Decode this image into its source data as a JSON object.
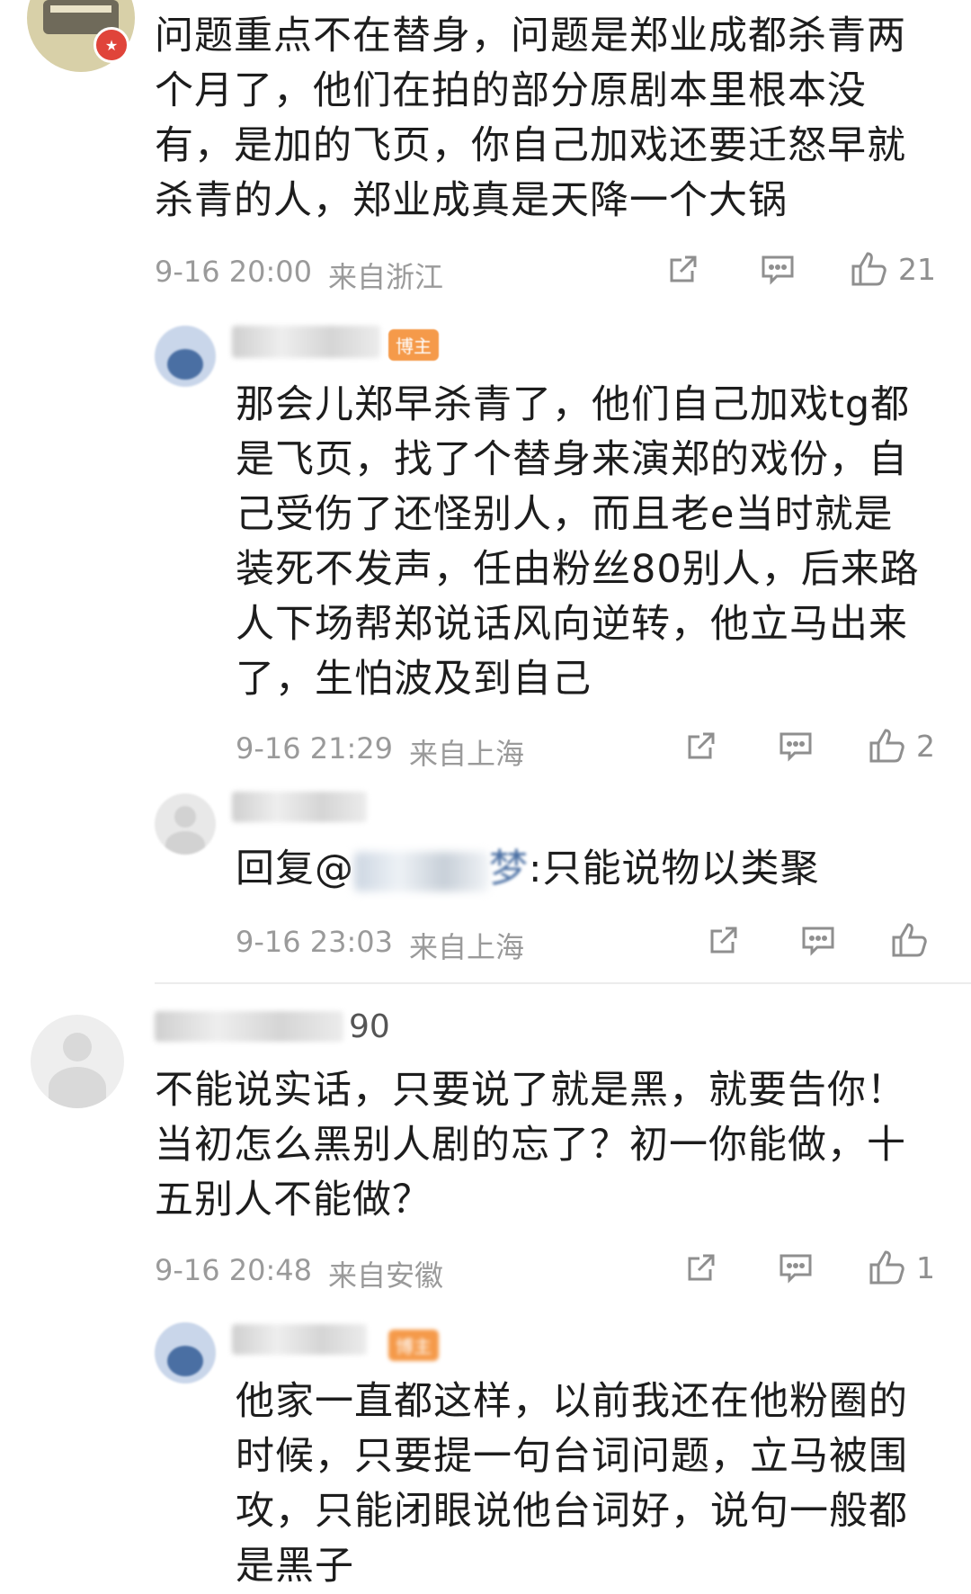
{
  "comments": [
    {
      "text": "问题重点不在替身，问题是郑业成都杀青两个月了，他们在拍的部分原剧本里根本没有，是加的飞页，你自己加戏还要迁怒早就杀青的人，郑业成真是天降一个大锅",
      "date": "9-16 20:00",
      "location": "来自浙江",
      "likes": "21",
      "replies": [
        {
          "badge": "博主",
          "text": "那会儿郑早杀青了，他们自己加戏tg都是飞页，找了个替身来演郑的戏份，自己受伤了还怪别人，而且老e当时就是装死不发声，任由粉丝80别人，后来路人下场帮郑说话风向逆转，他立马出来了，生怕波及到自己",
          "date": "9-16 21:29",
          "location": "来自上海",
          "likes": "2"
        },
        {
          "reply_prefix": "回复@",
          "reply_name_tail": "梦",
          "reply_text": ":只能说物以类聚",
          "date": "9-16 23:03",
          "location": "来自上海",
          "likes": ""
        }
      ]
    },
    {
      "username_tail": "90",
      "text": "不能说实话，只要说了就是黑，就要告你！当初怎么黑别人剧的忘了？初一你能做，十五别人不能做？",
      "date": "9-16 20:48",
      "location": "来自安徽",
      "likes": "1",
      "replies": [
        {
          "badge": "博主",
          "text": "他家一直都这样，以前我还在他粉圈的时候，只要提一句台词问题，立马被围攻，只能闭眼说他台词好，说句一般都是黑子"
        }
      ]
    }
  ],
  "icons": {
    "share": "share-icon",
    "comment": "comment-icon",
    "like": "like-icon"
  },
  "colors": {
    "text": "#1d1d1d",
    "meta": "#9a9a9a",
    "icon": "#8f8f8f",
    "badge": "#f59a4a",
    "divider": "#ececec"
  }
}
